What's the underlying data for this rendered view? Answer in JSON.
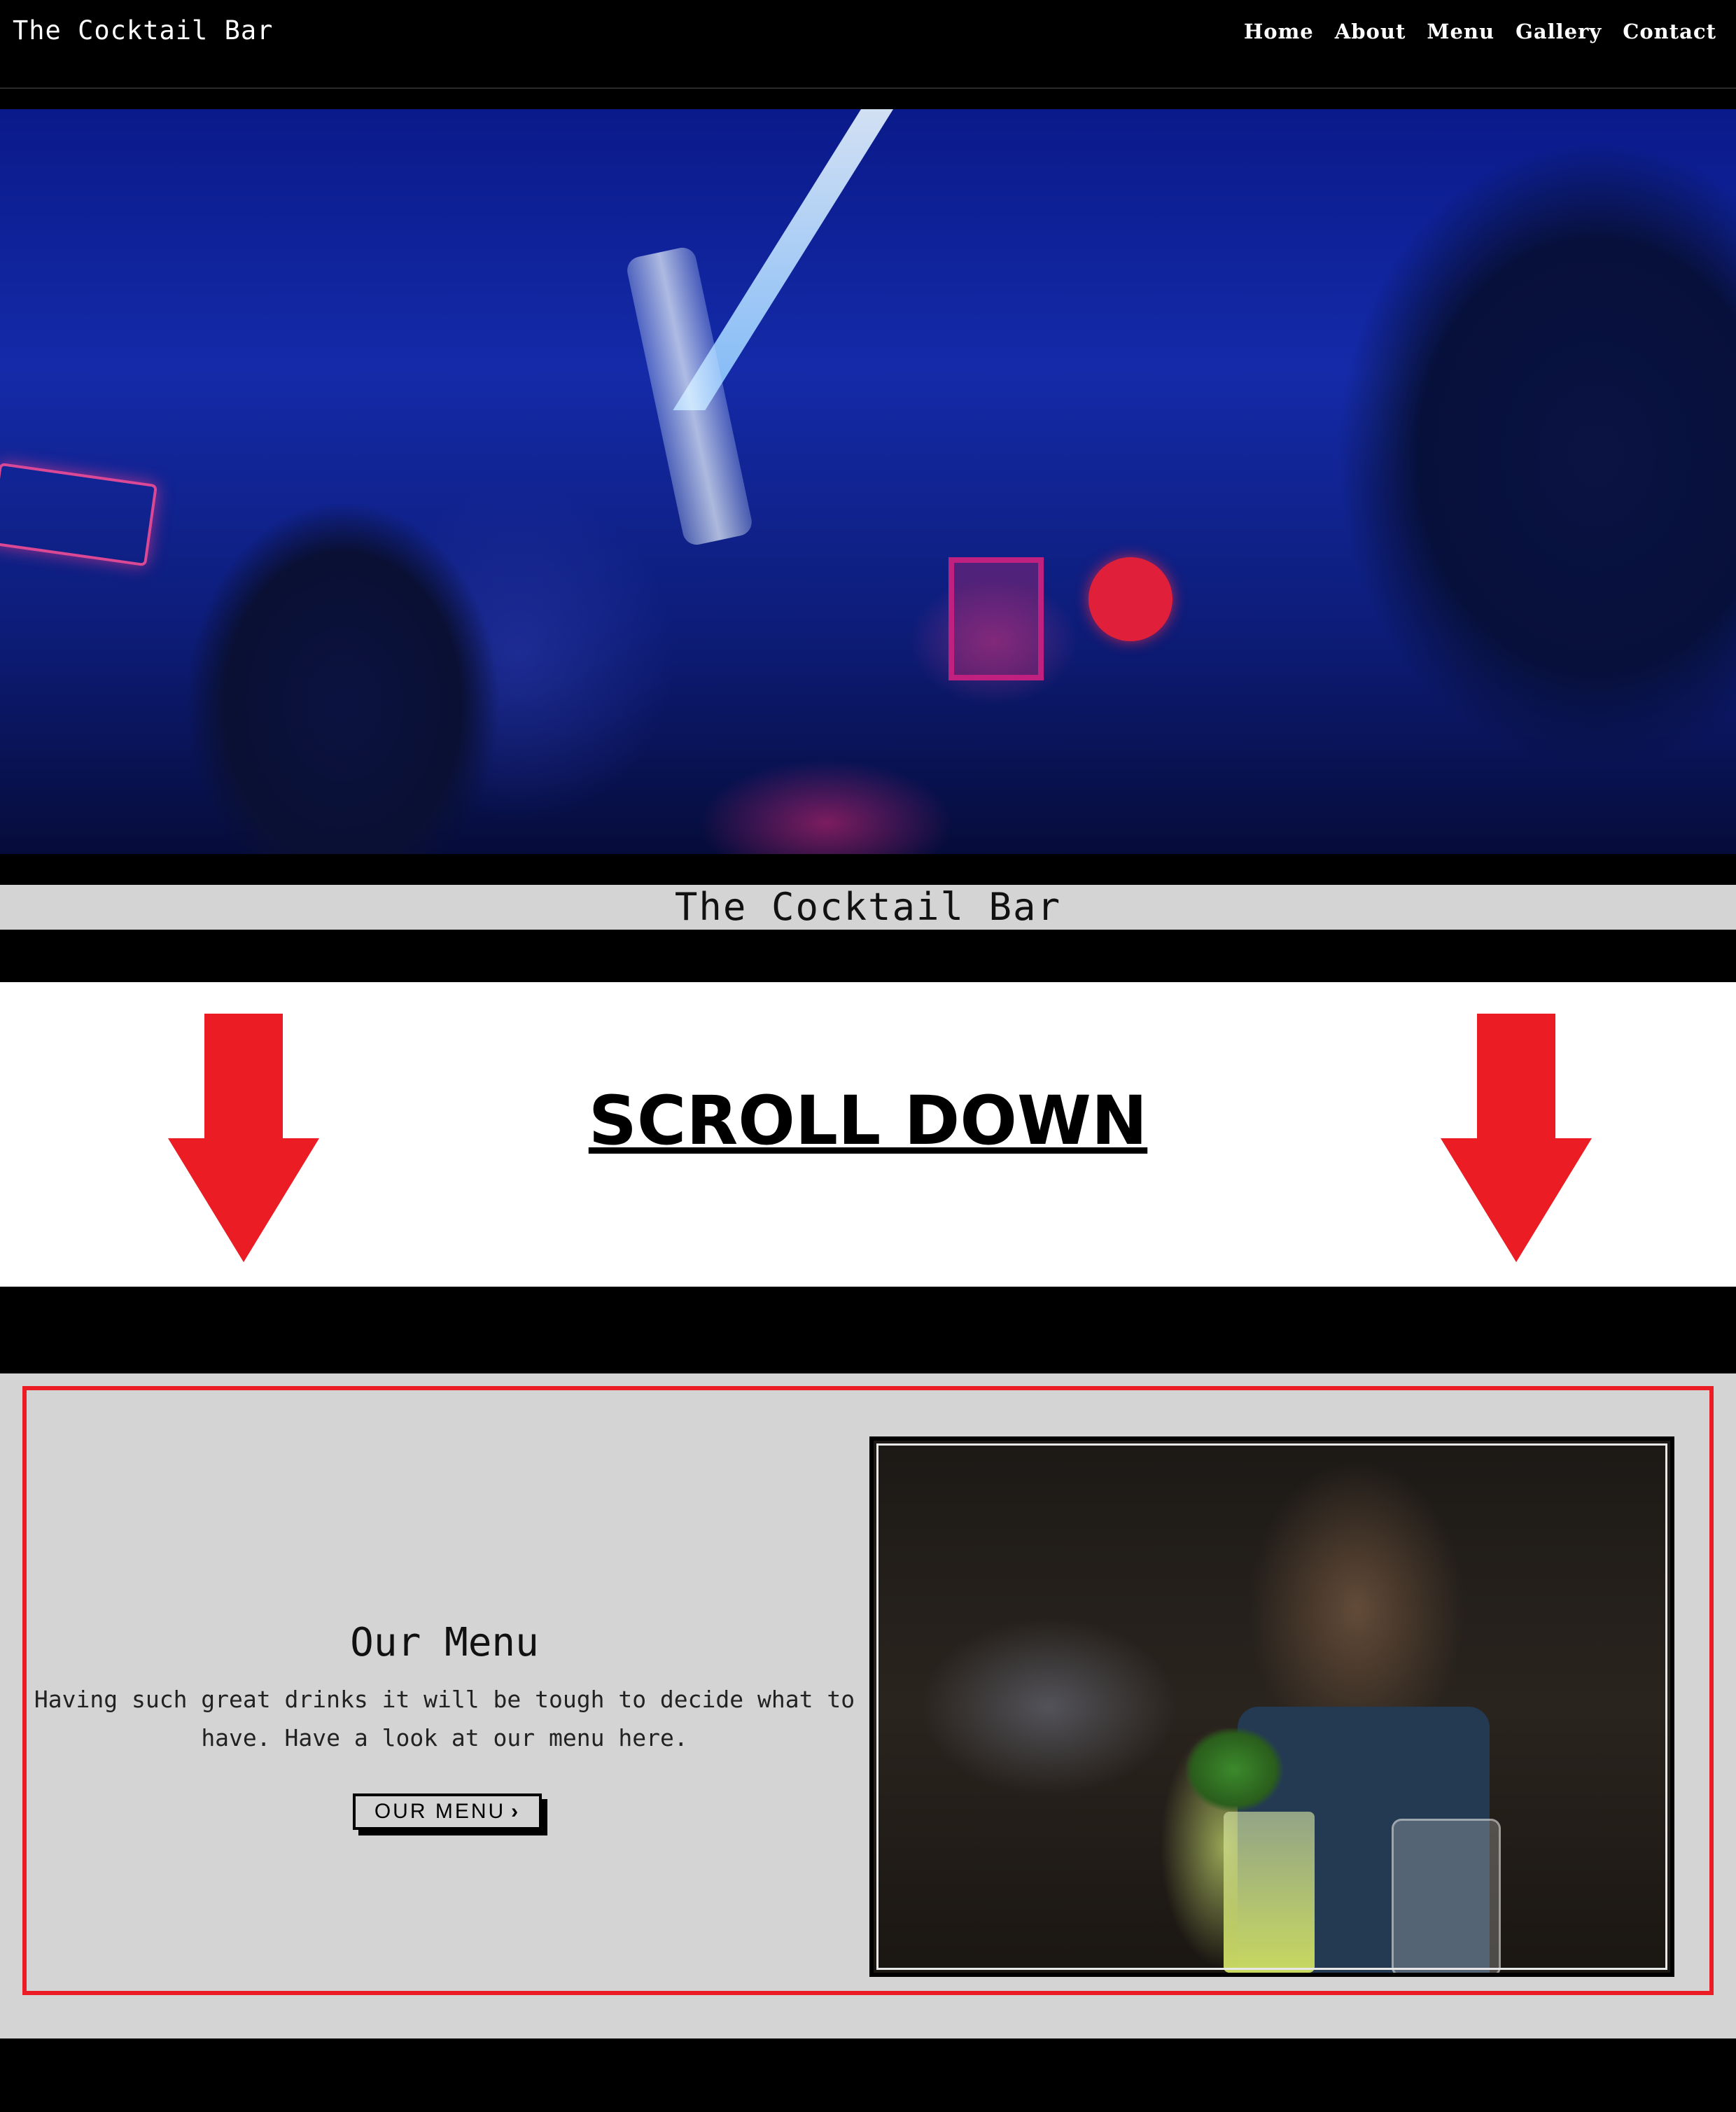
{
  "nav": {
    "brand": "The Cocktail Bar",
    "links": [
      "Home",
      "About",
      "Menu",
      "Gallery",
      "Contact"
    ]
  },
  "hero": {
    "image": "bartender-pouring-bottle-blue-neon-bar"
  },
  "banner": {
    "title": "The Cocktail Bar"
  },
  "annotation": {
    "text": "SCROLL DOWN",
    "arrow_color": "#ec1c24"
  },
  "menu_section": {
    "title": "Our Menu",
    "description": "Having such great drinks it will be tough to decide what to have. Have a look at our menu here.",
    "button_label": "OUR MENU",
    "button_icon": "chevron-right-icon",
    "image": "bartender-preparing-mint-cocktail",
    "highlight_color": "#ec1c24"
  }
}
